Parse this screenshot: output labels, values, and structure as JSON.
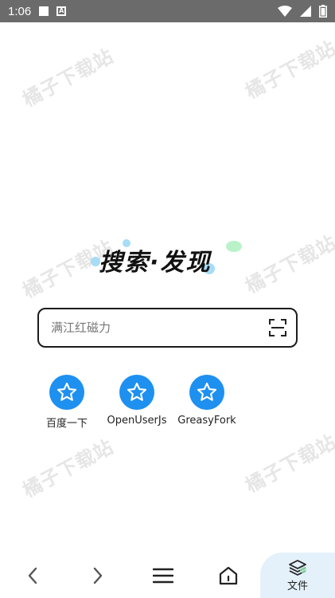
{
  "status_bar": {
    "time": "1:06",
    "icons": [
      "notification-square-icon",
      "a-box-icon",
      "wifi-icon",
      "signal-icon",
      "battery-icon"
    ]
  },
  "watermark": {
    "text": "橘子下载站"
  },
  "logo": {
    "text": "搜索·发现",
    "bubble_colors": [
      "#a6dcf7",
      "#b9f2c9"
    ]
  },
  "search": {
    "placeholder": "满江红磁力",
    "scan_icon": "scan-icon"
  },
  "shortcuts": [
    {
      "label": "百度一下",
      "icon": "star-icon"
    },
    {
      "label": "OpenUserJs",
      "icon": "star-icon"
    },
    {
      "label": "GreasyFork",
      "icon": "star-icon"
    }
  ],
  "bottom_nav": {
    "items": [
      "back-icon",
      "forward-icon",
      "menu-icon",
      "home-icon"
    ],
    "files_label": "文件"
  },
  "colors": {
    "accent": "#1e90f0",
    "status_bar": "#6b6b6b",
    "files_tab_bg": "#e4f1fb"
  }
}
